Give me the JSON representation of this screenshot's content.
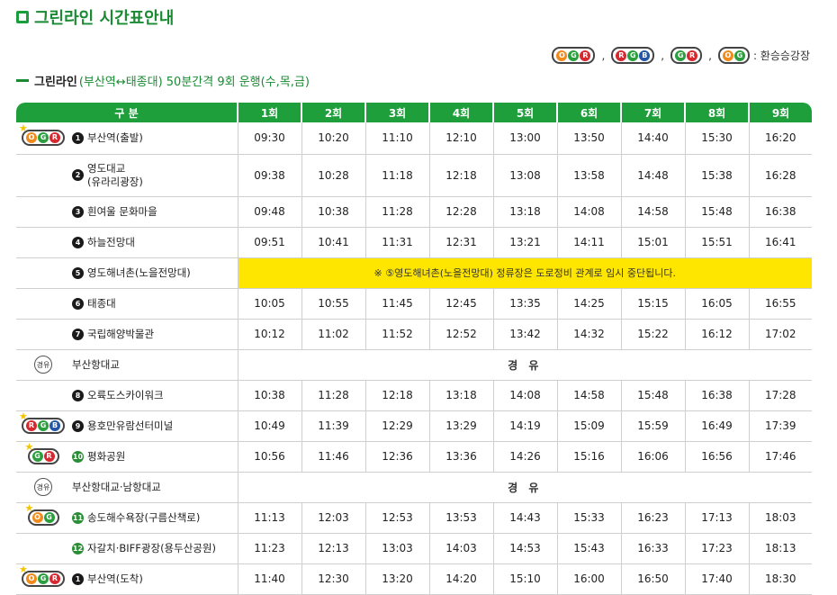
{
  "page_title": "그린라인 시간표안내",
  "legend": {
    "items": [
      {
        "dots": [
          "O",
          "G",
          "R"
        ],
        "colors": [
          "o",
          "g",
          "r"
        ]
      },
      {
        "dots": [
          "R",
          "G",
          "B"
        ],
        "colors": [
          "r",
          "g",
          "b"
        ]
      },
      {
        "dots": [
          "G",
          "R"
        ],
        "colors": [
          "g",
          "r"
        ]
      },
      {
        "dots": [
          "O",
          "G"
        ],
        "colors": [
          "o",
          "g"
        ]
      }
    ],
    "label": ": 환승승강장"
  },
  "route": {
    "name": "그린라인",
    "description": "(부산역↔태종대) 50분간격 9회 운행(수,목,금)"
  },
  "colors": {
    "header_green": "#1f9e3c",
    "notice_yellow": "#ffe600",
    "orange": "#f08a1c",
    "green": "#2b9e3d",
    "red": "#d8282f",
    "blue": "#2356a6"
  },
  "table": {
    "headers": [
      "구 분",
      "1회",
      "2회",
      "3회",
      "4회",
      "5회",
      "6회",
      "7회",
      "8회",
      "9회"
    ],
    "rows": [
      {
        "type": "stop",
        "transfer": [
          "O",
          "G",
          "R"
        ],
        "num": "1",
        "name": "부산역(출발)",
        "times": [
          "09:30",
          "10:20",
          "11:10",
          "12:10",
          "13:00",
          "13:50",
          "14:40",
          "15:30",
          "16:20"
        ]
      },
      {
        "type": "stop",
        "num": "2",
        "name": "영도대교",
        "name2": "(유라리광장)",
        "times": [
          "09:38",
          "10:28",
          "11:18",
          "12:18",
          "13:08",
          "13:58",
          "14:48",
          "15:38",
          "16:28"
        ]
      },
      {
        "type": "stop",
        "num": "3",
        "name": "흰여울 문화마을",
        "times": [
          "09:48",
          "10:38",
          "11:28",
          "12:28",
          "13:18",
          "14:08",
          "14:58",
          "15:48",
          "16:38"
        ]
      },
      {
        "type": "stop",
        "num": "4",
        "name": "하늘전망대",
        "times": [
          "09:51",
          "10:41",
          "11:31",
          "12:31",
          "13:21",
          "14:11",
          "15:01",
          "15:51",
          "16:41"
        ]
      },
      {
        "type": "notice",
        "num": "5",
        "name": "영도해녀촌(노을전망대)",
        "notice": "※ ⑤영도해녀촌(노을전망대) 정류장은 도로정비 관계로 임시 중단됩니다."
      },
      {
        "type": "stop",
        "num": "6",
        "name": "태종대",
        "times": [
          "10:05",
          "10:55",
          "11:45",
          "12:45",
          "13:35",
          "14:25",
          "15:15",
          "16:05",
          "16:55"
        ]
      },
      {
        "type": "stop",
        "num": "7",
        "name": "국립해양박물관",
        "times": [
          "10:12",
          "11:02",
          "11:52",
          "12:52",
          "13:42",
          "14:32",
          "15:22",
          "16:12",
          "17:02"
        ]
      },
      {
        "type": "via",
        "badge": "경유",
        "name": "부산항대교",
        "via": "경 유"
      },
      {
        "type": "stop",
        "num": "8",
        "name": "오륙도스카이워크",
        "times": [
          "10:38",
          "11:28",
          "12:18",
          "13:18",
          "14:08",
          "14:58",
          "15:48",
          "16:38",
          "17:28"
        ]
      },
      {
        "type": "stop",
        "transfer": [
          "R",
          "G",
          "B"
        ],
        "num": "9",
        "name": "용호만유람선터미널",
        "times": [
          "10:49",
          "11:39",
          "12:29",
          "13:29",
          "14:19",
          "15:09",
          "15:59",
          "16:49",
          "17:39"
        ]
      },
      {
        "type": "stop",
        "transfer": [
          "G",
          "R"
        ],
        "num": "10",
        "name": "평화공원",
        "times": [
          "10:56",
          "11:46",
          "12:36",
          "13:36",
          "14:26",
          "15:16",
          "16:06",
          "16:56",
          "17:46"
        ]
      },
      {
        "type": "via",
        "badge": "경유",
        "name": "부산항대교·남항대교",
        "via": "경 유"
      },
      {
        "type": "stop",
        "transfer": [
          "O",
          "G"
        ],
        "num": "11",
        "name": "송도해수욕장(구름산책로)",
        "times": [
          "11:13",
          "12:03",
          "12:53",
          "13:53",
          "14:43",
          "15:33",
          "16:23",
          "17:13",
          "18:03"
        ]
      },
      {
        "type": "stop",
        "num": "12",
        "name": "자갈치·BIFF광장(용두산공원)",
        "times": [
          "11:23",
          "12:13",
          "13:03",
          "14:03",
          "14:53",
          "15:43",
          "16:33",
          "17:23",
          "18:13"
        ]
      },
      {
        "type": "stop",
        "transfer": [
          "O",
          "G",
          "R"
        ],
        "num": "1",
        "name": "부산역(도착)",
        "times": [
          "11:40",
          "12:30",
          "13:20",
          "14:20",
          "15:10",
          "16:00",
          "16:50",
          "17:40",
          "18:30"
        ]
      }
    ]
  }
}
